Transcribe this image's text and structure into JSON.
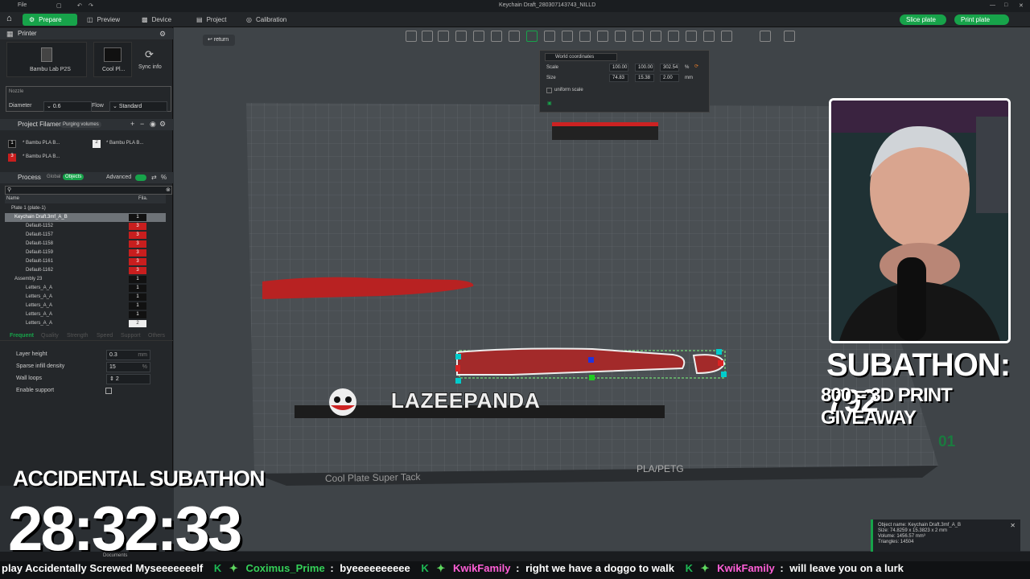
{
  "titlebar": {
    "menu": "File",
    "title": "Keychain Draft_280307143743_NILLD"
  },
  "menubar": {
    "tabs": [
      {
        "label": "Prepare",
        "active": true
      },
      {
        "label": "Preview",
        "active": false
      },
      {
        "label": "Device",
        "active": false
      },
      {
        "label": "Project",
        "active": false
      },
      {
        "label": "Calibration",
        "active": false
      }
    ],
    "slice_label": "Slice plate",
    "print_label": "Print plate"
  },
  "printer": {
    "section": "Printer",
    "printer_name": "Bambu Lab P2S",
    "plate_name": "Cool Pl...",
    "sync_label": "Sync info",
    "nozzle_label": "Nozzle",
    "diameter_label": "Diameter",
    "diameter_value": "0.6",
    "flow_label": "Flow",
    "flow_value": "Standard"
  },
  "filaments": {
    "section": "Project Filaments",
    "purge_label": "Purging volumes",
    "items": [
      {
        "num": "1",
        "name": "* Bambu PLA B...",
        "color": "#111111"
      },
      {
        "num": "2",
        "name": "* Bambu PLA B...",
        "color": "#eeeeee"
      },
      {
        "num": "3",
        "name": "* Bambu PLA B...",
        "color": "#c81e1e"
      }
    ]
  },
  "process": {
    "section": "Process",
    "global_label": "Global",
    "objects_label": "Objects",
    "advanced_label": "Advanced",
    "col_name": "Name",
    "col_fila": "Fila.",
    "rows": [
      {
        "name": "Plate 1 (plate-1)",
        "badge": ""
      },
      {
        "name": "Keychain Draft.3mf_A_B",
        "badge": "1"
      },
      {
        "name": "Default-1152",
        "badge": "3"
      },
      {
        "name": "Default-1157",
        "badge": "3"
      },
      {
        "name": "Default-1158",
        "badge": "3"
      },
      {
        "name": "Default-1159",
        "badge": "3"
      },
      {
        "name": "Default-1161",
        "badge": "3"
      },
      {
        "name": "Default-1162",
        "badge": "3"
      },
      {
        "name": "Assembly 23",
        "badge": "1"
      },
      {
        "name": "Letters_A_A",
        "badge": "1"
      },
      {
        "name": "Letters_A_A",
        "badge": "1"
      },
      {
        "name": "Letters_A_A",
        "badge": "1"
      },
      {
        "name": "Letters_A_A",
        "badge": "1"
      },
      {
        "name": "Letters_A_A",
        "badge": "2"
      }
    ],
    "tabs": [
      "Frequent",
      "Quality",
      "Strength",
      "Speed",
      "Support",
      "Others"
    ],
    "settings": [
      {
        "label": "Layer height",
        "value": "0.3",
        "unit": "mm"
      },
      {
        "label": "Sparse infill density",
        "value": "15",
        "unit": "%"
      },
      {
        "label": "Wall loops",
        "value": "2",
        "unit": ""
      },
      {
        "label": "Enable support",
        "value": "",
        "unit": ""
      }
    ]
  },
  "coords": {
    "title": "World coordinates",
    "scale_label": "Scale",
    "scale": [
      "100.00",
      "100.00",
      "302.54"
    ],
    "scale_unit": "%",
    "size_label": "Size",
    "size": [
      "74.83",
      "15.38",
      "2.00"
    ],
    "size_unit": "mm",
    "uniform_label": "uniform scale"
  },
  "viewport": {
    "return_label": "return",
    "plate_label": "Cool Plate Super Tack",
    "plate_type": "PLA/PETG",
    "plate_number": "01",
    "keychain_text": "LAZEEPANDA"
  },
  "object_info": {
    "name": "Object name: Keychain Draft.3mf_A_B",
    "size": "Size: 74.8259 x 15.3823 x 2 mm",
    "volume": "Volume: 1456.57 mm³",
    "triangles": "Triangles: 14504"
  },
  "overlay": {
    "subathon_title": "ACCIDENTAL SUBATHON",
    "timer": "28:32:33",
    "subathon_count": "SUBATHON: 792",
    "giveaway": "800 = 3D PRINT GIVEAWAY"
  },
  "chat": [
    {
      "user": "",
      "message": "play Accidentally Screwed Myseeeeeeelf"
    },
    {
      "user": "Coximus_Prime",
      "message": "byeeeeeeeeee"
    },
    {
      "user": "KwikFamily",
      "message": "right we have a doggo to walk"
    },
    {
      "user": "KwikFamily",
      "message": "will leave you on a lurk"
    }
  ],
  "taskbar": {
    "documents_label": "Documents"
  }
}
